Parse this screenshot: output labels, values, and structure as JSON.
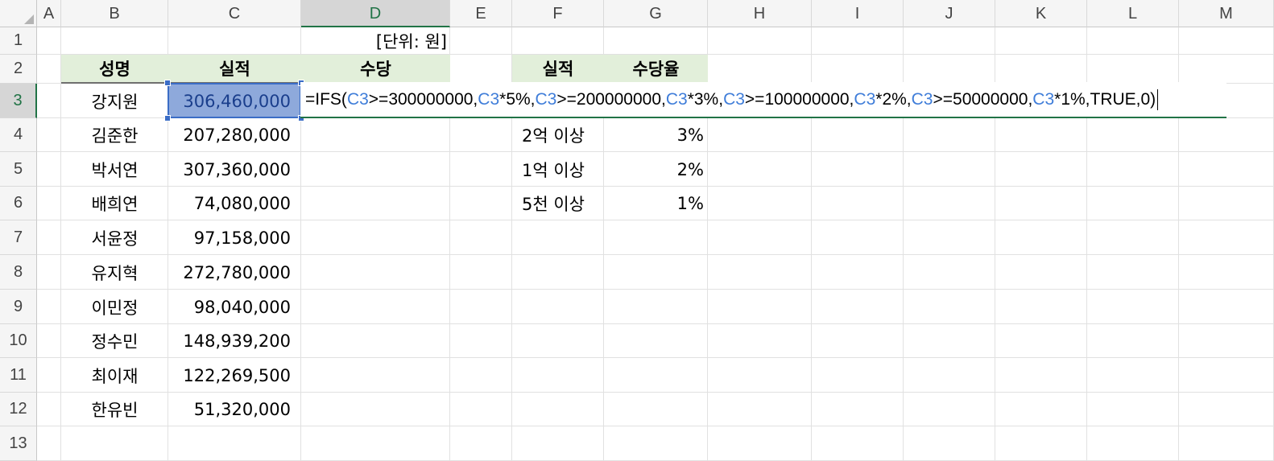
{
  "columns": [
    "A",
    "B",
    "C",
    "D",
    "E",
    "F",
    "G",
    "H",
    "I",
    "J",
    "K",
    "L",
    "M"
  ],
  "rows": [
    "1",
    "2",
    "3",
    "4",
    "5",
    "6",
    "7",
    "8",
    "9",
    "10",
    "11",
    "12",
    "13"
  ],
  "unit_note": "[단위: 원]",
  "table1": {
    "headers": [
      "성명",
      "실적",
      "수당"
    ],
    "rows": [
      {
        "name": "강지원",
        "perf": "306,460,000"
      },
      {
        "name": "김준한",
        "perf": "207,280,000"
      },
      {
        "name": "박서연",
        "perf": "307,360,000"
      },
      {
        "name": "배희연",
        "perf": "74,080,000"
      },
      {
        "name": "서윤정",
        "perf": "97,158,000"
      },
      {
        "name": "유지혁",
        "perf": "272,780,000"
      },
      {
        "name": "이민정",
        "perf": "98,040,000"
      },
      {
        "name": "정수민",
        "perf": "148,939,200"
      },
      {
        "name": "최이재",
        "perf": "122,269,500"
      },
      {
        "name": "한유빈",
        "perf": "51,320,000"
      }
    ]
  },
  "table2": {
    "headers": [
      "실적",
      "수당율"
    ],
    "rows": [
      {
        "label": "2억 이상",
        "rate": "3%"
      },
      {
        "label": "1억 이상",
        "rate": "2%"
      },
      {
        "label": "5천 이상",
        "rate": "1%"
      }
    ]
  },
  "formula": {
    "parts": [
      {
        "t": "=IFS(",
        "ref": false
      },
      {
        "t": "C3",
        "ref": true
      },
      {
        "t": ">=300000000,",
        "ref": false
      },
      {
        "t": "C3",
        "ref": true
      },
      {
        "t": "*5%,",
        "ref": false
      },
      {
        "t": "C3",
        "ref": true
      },
      {
        "t": ">=200000000,",
        "ref": false
      },
      {
        "t": "C3",
        "ref": true
      },
      {
        "t": "*3%,",
        "ref": false
      },
      {
        "t": "C3",
        "ref": true
      },
      {
        "t": ">=100000000,",
        "ref": false
      },
      {
        "t": "C3",
        "ref": true
      },
      {
        "t": "*2%,",
        "ref": false
      },
      {
        "t": "C3",
        "ref": true
      },
      {
        "t": ">=50000000,",
        "ref": false
      },
      {
        "t": "C3",
        "ref": true
      },
      {
        "t": "*1%,TRUE,0)",
        "ref": false
      }
    ]
  },
  "colors": {
    "header_fill": "#e2efda",
    "selection_fill": "#8ea9db",
    "selection_border": "#3b6dc6",
    "ref_blue": "#3f7dd9",
    "excel_green": "#217346"
  }
}
